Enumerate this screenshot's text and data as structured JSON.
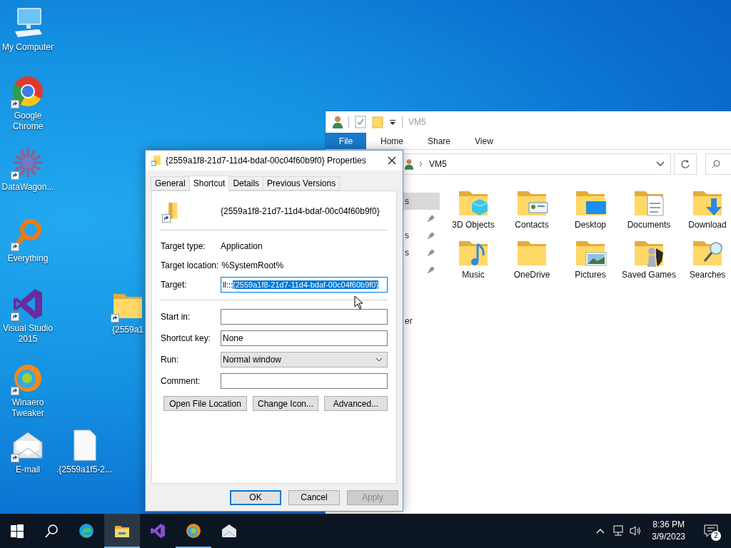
{
  "desktop_icons": [
    {
      "label": "My Computer",
      "kind": "computer",
      "shortcut": false
    },
    {
      "label": "Google Chrome",
      "kind": "chrome",
      "shortcut": true
    },
    {
      "label": "DataWagon...",
      "kind": "datawagon",
      "shortcut": true
    },
    {
      "label": "Everything",
      "kind": "everything",
      "shortcut": true
    },
    {
      "label": "Visual Studio 2015",
      "kind": "vs",
      "shortcut": true
    },
    {
      "label": "Winaero Tweaker",
      "kind": "winaero",
      "shortcut": true
    },
    {
      "label": "E-mail",
      "kind": "email",
      "shortcut": true
    },
    {
      "label": "{2559a1",
      "kind": "folder",
      "shortcut": true
    },
    {
      "label": ".{2559a1f5-2...",
      "kind": "file",
      "shortcut": false
    }
  ],
  "explorer": {
    "title": "VM5",
    "ribbon_tabs": [
      {
        "label": "File",
        "kind": "file"
      },
      {
        "label": "Home",
        "kind": "tab"
      },
      {
        "label": "Share",
        "kind": "tab"
      },
      {
        "label": "View",
        "kind": "tab"
      }
    ],
    "path": "VM5",
    "nav_items": [
      {
        "label": "s",
        "selected": true,
        "pinned": false
      },
      {
        "selected": false,
        "pinned": true
      },
      {
        "label": "s",
        "selected": false,
        "pinned": true
      },
      {
        "label": "s",
        "selected": false,
        "pinned": true
      },
      {
        "selected": false,
        "pinned": true
      },
      {
        "selected": false,
        "pinned": false
      },
      {
        "selected": false,
        "pinned": false
      },
      {
        "label": "er",
        "selected": false,
        "pinned": false
      }
    ],
    "folders": [
      {
        "label": "3D Objects",
        "kind": "objects"
      },
      {
        "label": "Contacts",
        "kind": "contacts"
      },
      {
        "label": "Desktop",
        "kind": "desktop"
      },
      {
        "label": "Documents",
        "kind": "documents"
      },
      {
        "label": "Download",
        "kind": "downloads"
      },
      {
        "label": "Music",
        "kind": "music"
      },
      {
        "label": "OneDrive",
        "kind": "plain"
      },
      {
        "label": "Pictures",
        "kind": "pictures"
      },
      {
        "label": "Saved Games",
        "kind": "games"
      },
      {
        "label": "Searches",
        "kind": "searches"
      }
    ]
  },
  "dialog": {
    "title": "{2559a1f8-21d7-11d4-bdaf-00c04f60b9f0} Properties",
    "tabs": [
      {
        "label": "General",
        "selected": false
      },
      {
        "label": "Shortcut",
        "selected": true
      },
      {
        "label": "Details",
        "selected": false
      },
      {
        "label": "Previous Versions",
        "selected": false
      }
    ],
    "name": "{2559a1f8-21d7-11d4-bdaf-00c04f60b9f0}",
    "info": [
      {
        "label": "Target type:",
        "value": "Application"
      },
      {
        "label": "Target location:",
        "value": "%SystemRoot%"
      }
    ],
    "target": {
      "label": "Target:",
      "value": "ll:::",
      "selected_text": "{2559a1f8-21d7-11d4-bdaf-00c04f60b9f0}"
    },
    "fields": [
      {
        "label": "Start in:",
        "kind": "text"
      },
      {
        "label": "Shortcut key:",
        "kind": "text",
        "value": "None"
      },
      {
        "label": "Run:",
        "kind": "select",
        "value": "Normal window"
      },
      {
        "label": "Comment:",
        "kind": "text"
      }
    ],
    "actions": [
      "Open File Location",
      "Change Icon...",
      "Advanced..."
    ],
    "footer": [
      {
        "label": "OK",
        "default": true,
        "disabled": false
      },
      {
        "label": "Cancel",
        "default": false,
        "disabled": false
      },
      {
        "label": "Apply",
        "default": false,
        "disabled": true
      }
    ]
  },
  "taskbar": {
    "apps": [
      {
        "kind": "start",
        "active": false,
        "running": false
      },
      {
        "kind": "search",
        "active": false,
        "running": false
      },
      {
        "kind": "edge",
        "active": false,
        "running": false
      },
      {
        "kind": "explorer",
        "active": true,
        "running": true
      },
      {
        "kind": "vs",
        "active": false,
        "running": false
      },
      {
        "kind": "winaero",
        "active": false,
        "running": true
      },
      {
        "kind": "email",
        "active": false,
        "running": false
      }
    ],
    "time": "8:36 PM",
    "date": "3/9/2023",
    "notifications": "2"
  }
}
